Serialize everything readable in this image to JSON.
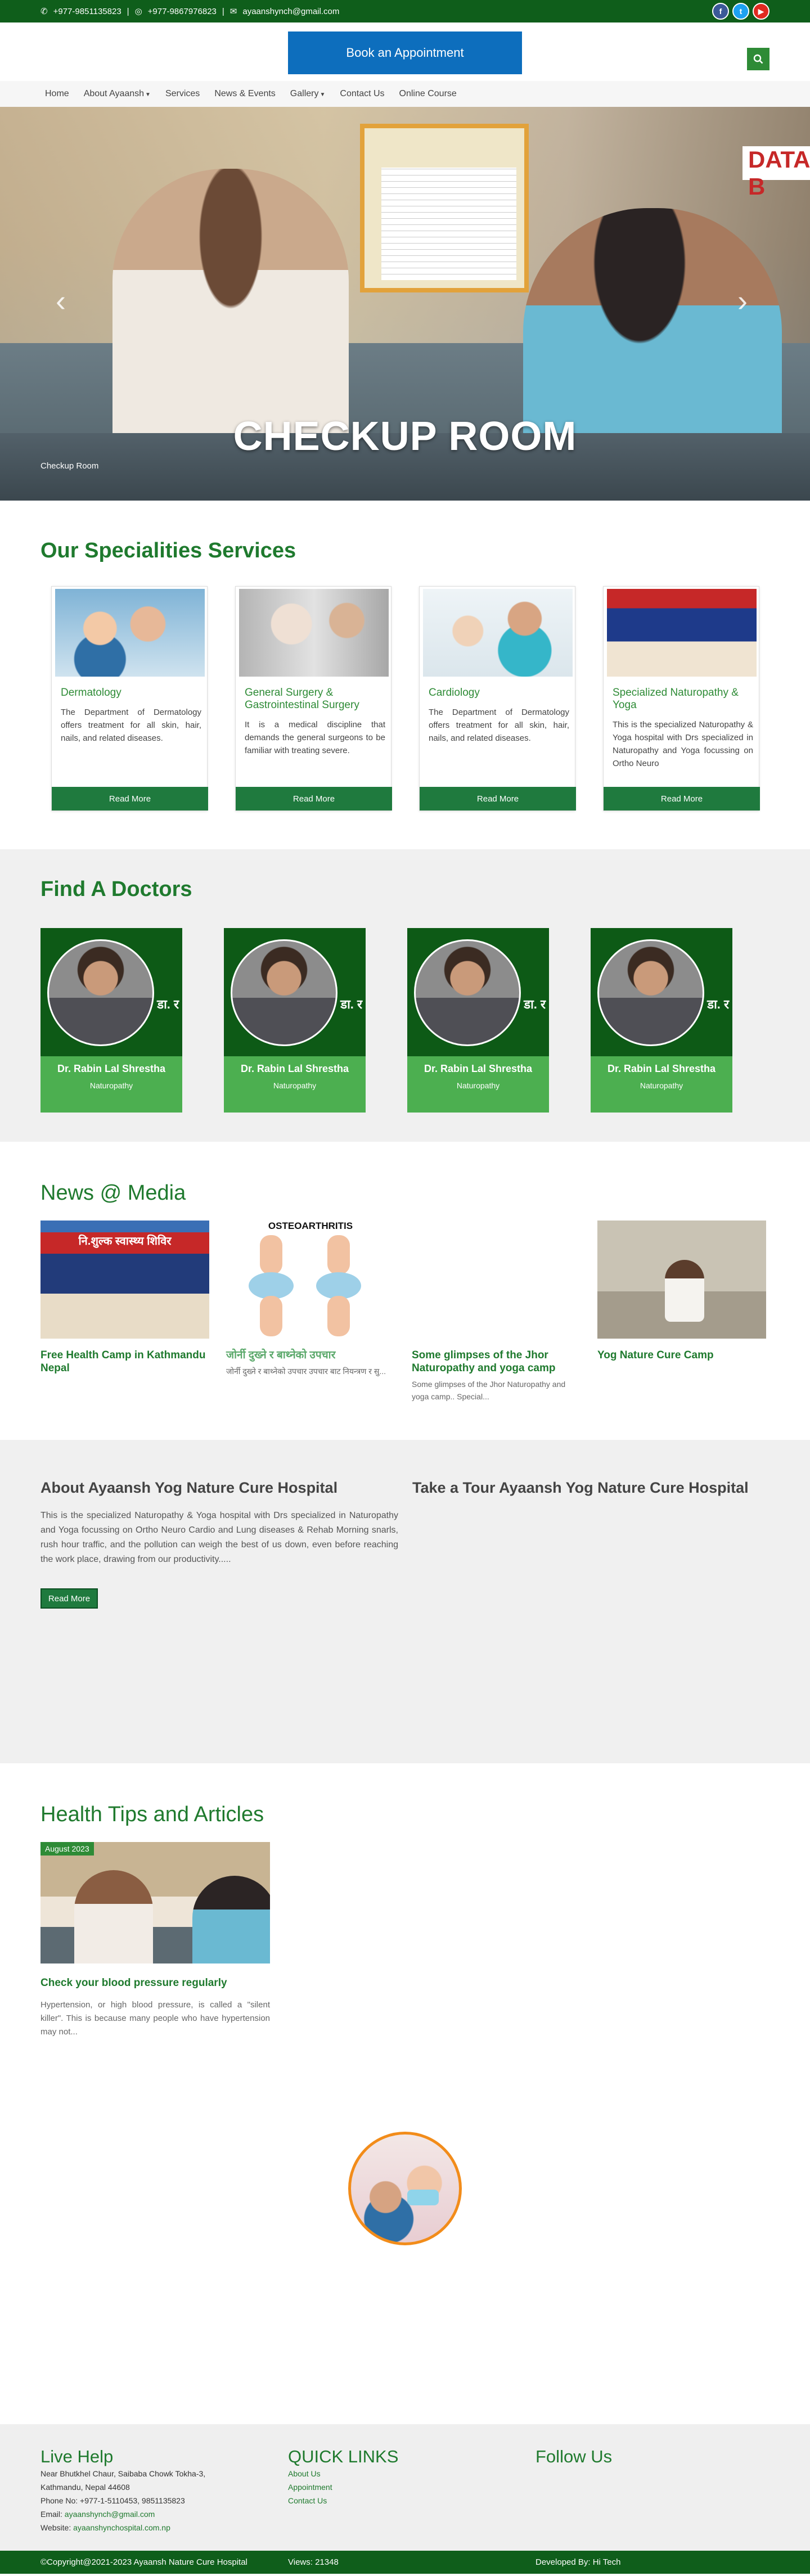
{
  "topbar": {
    "phone1": "+977-9851135823",
    "phone2": "+977-9867976823",
    "email": "ayaanshynch@gmail.com",
    "socials": [
      "facebook-icon",
      "twitter-icon",
      "youtube-icon"
    ]
  },
  "header": {
    "book_label": "Book an Appointment"
  },
  "nav": {
    "items": [
      "Home",
      "About Ayaansh",
      "Services",
      "News & Events",
      "Gallery",
      "Contact Us",
      "Online Course"
    ]
  },
  "hero": {
    "title": "CHECKUP ROOM",
    "caption": "Checkup Room",
    "board_sign": "DATA B"
  },
  "specialities": {
    "heading": "Our Specialities Services",
    "read_more": "Read More",
    "cards": [
      {
        "title": "Dermatology",
        "desc": "The Department of Dermatology offers treatment for all skin, hair, nails, and related diseases."
      },
      {
        "title": "General Surgery & Gastrointestinal Surgery",
        "desc": "It is a medical discipline that demands the general surgeons to be familiar with treating severe."
      },
      {
        "title": "Cardiology",
        "desc": "The Department of Dermatology offers treatment for all skin, hair, nails, and related diseases."
      },
      {
        "title": "Specialized Naturopathy & Yoga",
        "desc": "This is the specialized Naturopathy & Yoga hospital with Drs specialized in Naturopathy and Yoga focussing on Ortho Neuro"
      }
    ]
  },
  "doctors": {
    "heading": "Find A Doctors",
    "items": [
      {
        "name": "Dr. Rabin Lal Shrestha",
        "role": "Naturopathy"
      },
      {
        "name": "Dr. Rabin Lal Shrestha",
        "role": "Naturopathy"
      },
      {
        "name": "Dr. Rabin Lal Shrestha",
        "role": "Naturopathy"
      },
      {
        "name": "Dr. Rabin Lal Shrestha",
        "role": "Naturopathy"
      }
    ],
    "banner_text": "डा. र"
  },
  "news": {
    "heading": "News @ Media",
    "items": [
      {
        "title": "Free Health Camp in Kathmandu Nepal",
        "desc": "",
        "img_label": "नि.शुल्क स्वास्थ्य शिविर"
      },
      {
        "title": "जोर्नी दुख्ने र बाथ्नेको उपचार",
        "desc": "जोर्नी दुख्ने र बाथ्नेको उपचार उपचार बाट नियन्त्रण र सु...",
        "img_label": "OSTEOARTHRITIS"
      },
      {
        "title": "Some glimpses of the Jhor Naturopathy and yoga camp",
        "desc": "Some glimpses of the Jhor Naturopathy and yoga camp.. Special...",
        "img_label": ""
      },
      {
        "title": "Yog Nature Cure Camp",
        "desc": "",
        "img_label": ""
      }
    ]
  },
  "about": {
    "heading": "About Ayaansh Yog Nature Cure Hospital",
    "text": "This is the specialized Naturopathy & Yoga hospital with Drs specialized in Naturopathy and Yoga focussing on Ortho Neuro Cardio and Lung diseases & Rehab Morning snarls, rush hour traffic, and the pollution can weigh the best of us down, even before reaching the work place, drawing from our productivity.....",
    "button": "Read More",
    "tour_heading": "Take a Tour Ayaansh Yog Nature Cure Hospital"
  },
  "health": {
    "heading": "Health Tips and Articles",
    "article": {
      "date": "August 2023",
      "title": "Check your blood pressure regularly",
      "desc": "Hypertension, or high blood pressure, is called a \"silent killer\". This is because many people who have hypertension may not..."
    }
  },
  "footer": {
    "live_help": "Live Help",
    "address1": "Near Bhutkhel Chaur, Saibaba Chowk Tokha-3,",
    "address2": "Kathmandu, Nepal 44608",
    "phone": "Phone No: +977-1-5110453, 9851135823",
    "email_label": "Email:",
    "email": "ayaanshynch@gmail.com",
    "website_label": "Website:",
    "website": "ayaanshynchospital.com.np",
    "quick_links": "QUICK LINKS",
    "links": [
      "About Us",
      "Appointment",
      "Contact Us"
    ],
    "follow": "Follow Us"
  },
  "bottom": {
    "copyright": "©Copyright@2021-2023 Ayaansh Nature Cure Hospital",
    "views": "Views: 21348",
    "developed": "Developed By: Hi Tech"
  },
  "colors": {
    "brand_green": "#0f5e1b",
    "accent_green": "#1f7a2e",
    "blue": "#0d6ebd"
  }
}
